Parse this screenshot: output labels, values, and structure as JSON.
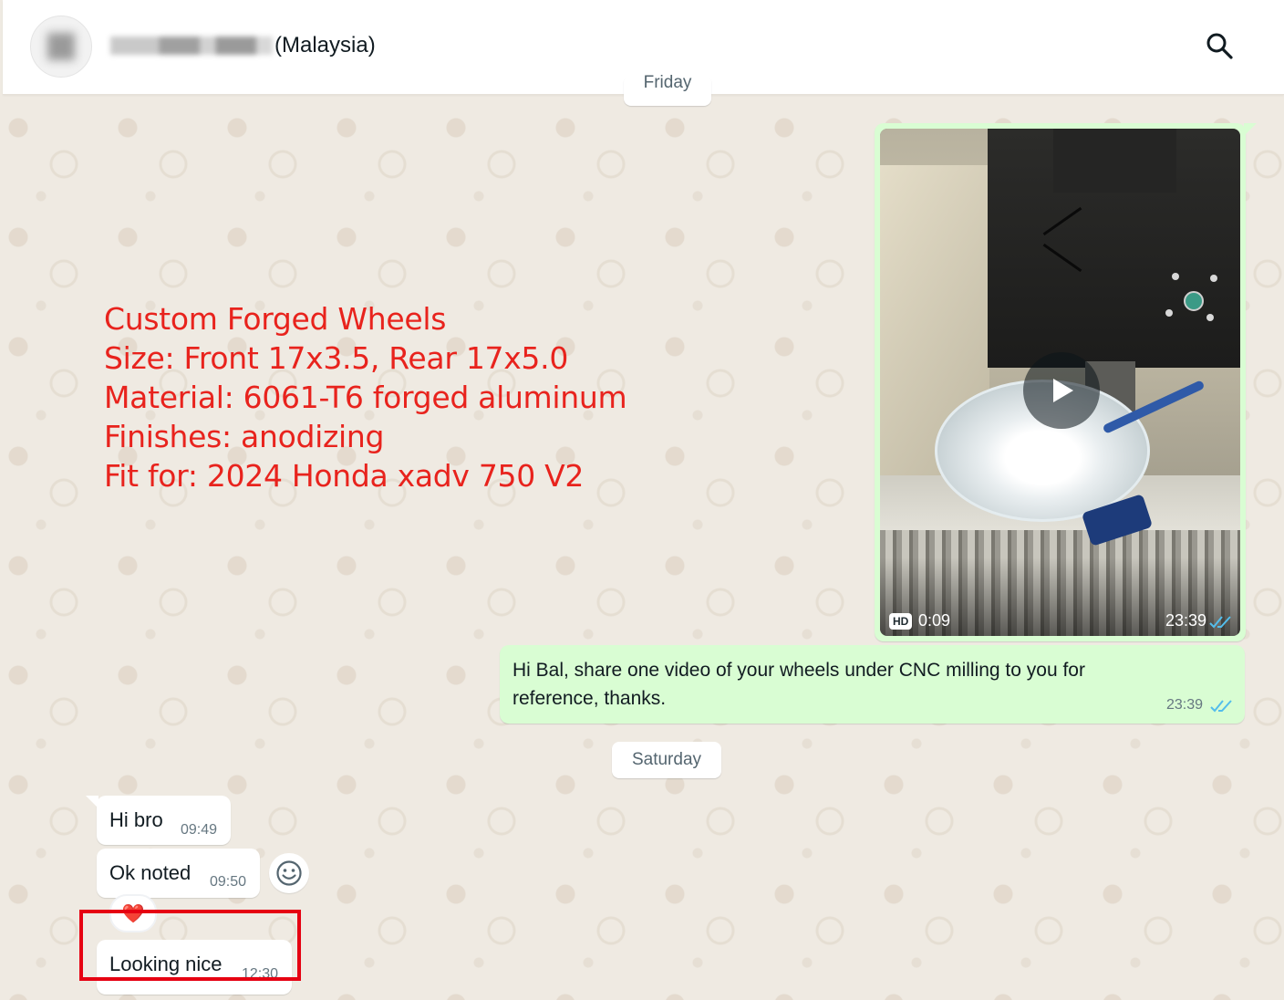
{
  "header": {
    "contact_name_visible": "(Malaysia)",
    "search_icon": "search-icon"
  },
  "day_separators": {
    "friday": "Friday",
    "saturday": "Saturday"
  },
  "overlay_annotation": {
    "lines": [
      "Custom Forged Wheels",
      "Size: Front 17x3.5, Rear 17x5.0",
      "Material: 6061-T6 forged aluminum",
      "Finishes: anodizing",
      "Fit for: 2024 Honda xadv 750 V2"
    ],
    "color": "#e8231d"
  },
  "messages": {
    "video": {
      "badge": "HD",
      "duration": "0:09",
      "time": "23:39",
      "status_icon": "double-check-read-icon"
    },
    "outgoing_text": {
      "text": "Hi Bal, share one video of your wheels under CNC milling to you for reference, thanks.",
      "time": "23:39",
      "status_icon": "double-check-read-icon"
    },
    "incoming": [
      {
        "text": "Hi bro",
        "time": "09:49"
      },
      {
        "text": "Ok noted",
        "time": "09:50",
        "reaction": "❤️"
      },
      {
        "text": "Looking nice",
        "time": "12:30"
      }
    ]
  },
  "colors": {
    "outgoing_bubble": "#d9fdd3",
    "incoming_bubble": "#ffffff",
    "chat_background": "#efeae2",
    "read_tick": "#53bdeb",
    "highlight_box": "#e60012"
  }
}
